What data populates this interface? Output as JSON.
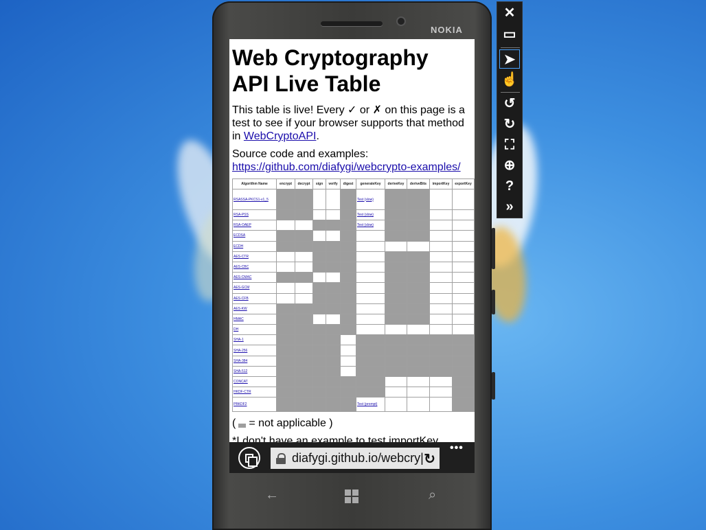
{
  "device": {
    "brand": "NOKIA"
  },
  "page": {
    "title": "Web Cryptography API Live Table",
    "intro_pre": "This table is live! Every ✓ or ✗ on this page is a test to see if your browser supports that method in ",
    "intro_link": "WebCryptoAPI",
    "intro_post": ".",
    "source_label": "Source code and examples:",
    "source_url": "https://github.com/diafygi/webcrypto-examples/",
    "legend_open": "(",
    "legend_text": "= not applicable )",
    "note": "*I don't have an example to test importKey."
  },
  "table": {
    "headers": [
      "Algorithm Name",
      "encrypt",
      "decrypt",
      "sign",
      "verify",
      "digest",
      "generateKey",
      "deriveKey",
      "deriveBits",
      "importKey",
      "exportKey"
    ],
    "rows": [
      {
        "name": "RSASSA-PKCS1-v1_5",
        "cells": [
          "na",
          "na",
          "",
          "",
          "na",
          "Test (slow)",
          "na",
          "na",
          "",
          ""
        ]
      },
      {
        "name": "RSA-PSS",
        "cells": [
          "na",
          "na",
          "",
          "",
          "na",
          "Test (slow)",
          "na",
          "na",
          "",
          ""
        ]
      },
      {
        "name": "RSA-OAEP",
        "cells": [
          "",
          "",
          "na",
          "na",
          "na",
          "Test (slow)",
          "na",
          "na",
          "",
          ""
        ]
      },
      {
        "name": "ECDSA",
        "cells": [
          "na",
          "na",
          "",
          "",
          "na",
          "",
          "na",
          "na",
          "",
          ""
        ]
      },
      {
        "name": "ECDH",
        "cells": [
          "na",
          "na",
          "na",
          "na",
          "na",
          "",
          "",
          "",
          "",
          ""
        ]
      },
      {
        "name": "AES-CTR",
        "cells": [
          "",
          "",
          "na",
          "na",
          "na",
          "",
          "na",
          "na",
          "",
          ""
        ]
      },
      {
        "name": "AES-CBC",
        "cells": [
          "",
          "",
          "na",
          "na",
          "na",
          "",
          "na",
          "na",
          "",
          ""
        ]
      },
      {
        "name": "AES-CMAC",
        "cells": [
          "na",
          "na",
          "",
          "",
          "na",
          "",
          "na",
          "na",
          "",
          ""
        ]
      },
      {
        "name": "AES-GCM",
        "cells": [
          "",
          "",
          "na",
          "na",
          "na",
          "",
          "na",
          "na",
          "",
          ""
        ]
      },
      {
        "name": "AES-CFB",
        "cells": [
          "",
          "",
          "na",
          "na",
          "na",
          "",
          "na",
          "na",
          "",
          ""
        ]
      },
      {
        "name": "AES-KW",
        "cells": [
          "na",
          "na",
          "na",
          "na",
          "na",
          "",
          "na",
          "na",
          "",
          ""
        ]
      },
      {
        "name": "HMAC",
        "cells": [
          "na",
          "na",
          "",
          "",
          "na",
          "",
          "na",
          "na",
          "",
          ""
        ]
      },
      {
        "name": "DH",
        "cells": [
          "na",
          "na",
          "na",
          "na",
          "na",
          "",
          "",
          "",
          "",
          ""
        ]
      },
      {
        "name": "SHA-1",
        "cells": [
          "na",
          "na",
          "na",
          "na",
          "",
          "na",
          "na",
          "na",
          "na",
          "na"
        ]
      },
      {
        "name": "SHA-256",
        "cells": [
          "na",
          "na",
          "na",
          "na",
          "",
          "na",
          "na",
          "na",
          "na",
          "na"
        ]
      },
      {
        "name": "SHA-384",
        "cells": [
          "na",
          "na",
          "na",
          "na",
          "",
          "na",
          "na",
          "na",
          "na",
          "na"
        ]
      },
      {
        "name": "SHA-512",
        "cells": [
          "na",
          "na",
          "na",
          "na",
          "",
          "na",
          "na",
          "na",
          "na",
          "na"
        ]
      },
      {
        "name": "CONCAT",
        "cells": [
          "na",
          "na",
          "na",
          "na",
          "na",
          "na",
          "",
          "",
          "",
          "na"
        ]
      },
      {
        "name": "HKDF-CTR",
        "cells": [
          "na",
          "na",
          "na",
          "na",
          "na",
          "na",
          "",
          "",
          "",
          "na"
        ]
      },
      {
        "name": "PBKDF2",
        "cells": [
          "na",
          "na",
          "na",
          "na",
          "na",
          "Test (prompt)",
          "",
          "",
          "",
          "na"
        ]
      }
    ]
  },
  "browser": {
    "url": "diafygi.github.io/webcry|",
    "more": "•••"
  },
  "colors": {
    "not_applicable": "#9e9e9e",
    "link": "#1a0dab",
    "desktop": "#3d8fe0"
  }
}
